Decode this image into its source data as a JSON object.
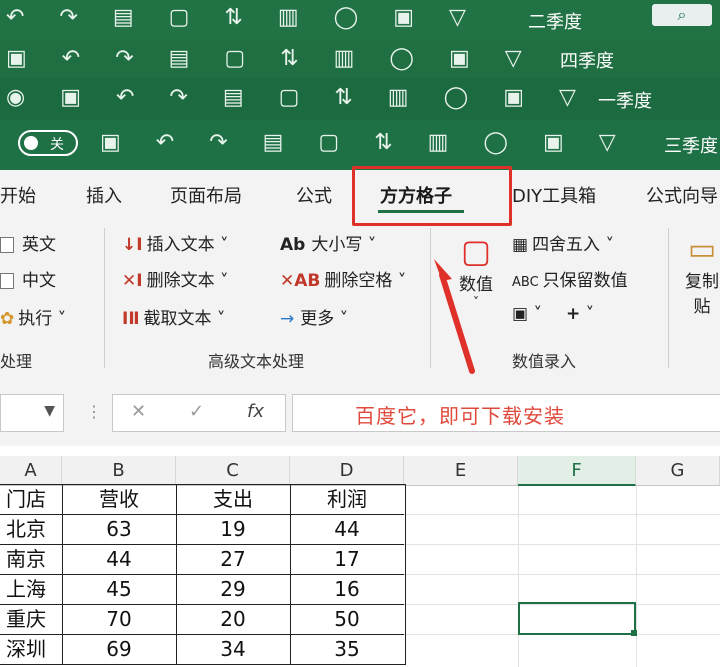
{
  "window_stack": [
    {
      "title": "二季度",
      "search_icon": "magnifier-icon"
    },
    {
      "title": "四季度"
    },
    {
      "title": "一季度"
    }
  ],
  "front_window": {
    "title": "三季度",
    "autosave_label": "关"
  },
  "tabs": [
    "开始",
    "插入",
    "页面布局",
    "公式",
    "方方格子",
    "DIY工具箱",
    "公式向导"
  ],
  "active_tab": "方方格子",
  "ribbon": {
    "left_group": {
      "items": [
        "英文",
        "中文",
        "执行"
      ],
      "label": "处理"
    },
    "text_group": {
      "items": [
        "插入文本",
        "删除文本",
        "截取文本",
        "大小写",
        "删除空格",
        "更多"
      ],
      "label": "高级文本处理"
    },
    "number_group": {
      "big_button": "数值",
      "items": [
        "四舍五入",
        "只保留数值"
      ],
      "label": "数值录入"
    },
    "clip_group": {
      "big_button_line1": "复制",
      "big_button_line2": "贴"
    }
  },
  "formula_bar": {
    "fx": "fx",
    "value": "百度它，即可下载安装"
  },
  "columns": [
    "A",
    "B",
    "C",
    "D",
    "E",
    "F",
    "G"
  ],
  "selected_column": "F",
  "table": {
    "headers": [
      "门店",
      "营收",
      "支出",
      "利润"
    ],
    "rows": [
      [
        "北京",
        "63",
        "19",
        "44"
      ],
      [
        "南京",
        "44",
        "27",
        "17"
      ],
      [
        "上海",
        "45",
        "29",
        "16"
      ],
      [
        "重庆",
        "70",
        "20",
        "50"
      ],
      [
        "深圳",
        "69",
        "34",
        "35"
      ]
    ]
  },
  "colors": {
    "excel_green": "#1e7145",
    "annotation_red": "#e0302a"
  }
}
